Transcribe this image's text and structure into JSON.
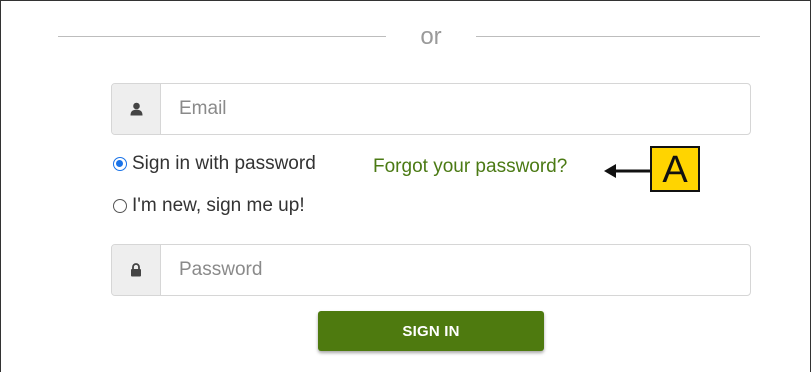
{
  "divider": {
    "text": "or"
  },
  "email": {
    "placeholder": "Email",
    "icon": "user-icon"
  },
  "options": {
    "password_label": "Sign in with password",
    "new_label": "I'm new, sign me up!",
    "selected": "password"
  },
  "forgot": {
    "label": "Forgot your password?"
  },
  "callout": {
    "label": "A"
  },
  "password": {
    "placeholder": "Password",
    "icon": "lock-icon"
  },
  "signin": {
    "label": "SIGN IN"
  },
  "colors": {
    "accent_green": "#4e7a0f",
    "link_green": "#4b7a14",
    "callout_yellow": "#ffd400",
    "radio_blue": "#1a73e8"
  }
}
